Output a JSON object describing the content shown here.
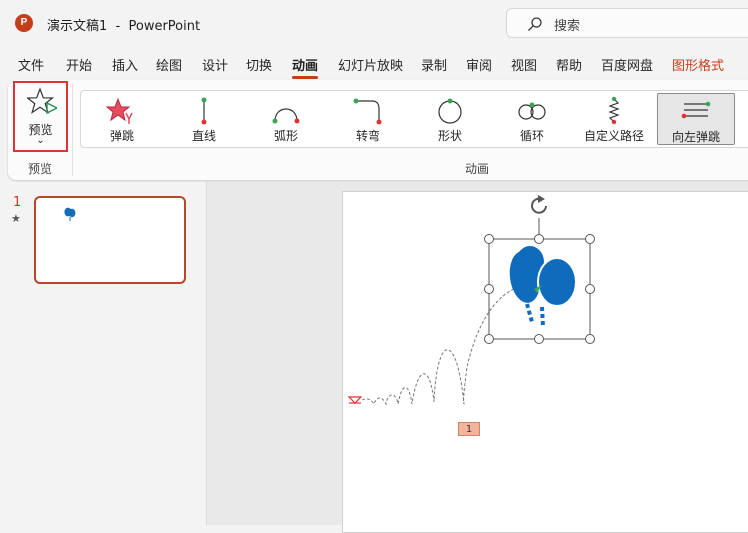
{
  "window": {
    "app_icon": "P",
    "title": "演示文稿1  -  PowerPoint",
    "search_placeholder": "搜索"
  },
  "tabs": [
    {
      "label": "文件"
    },
    {
      "label": "开始"
    },
    {
      "label": "插入"
    },
    {
      "label": "绘图"
    },
    {
      "label": "设计"
    },
    {
      "label": "切换"
    },
    {
      "label": "动画"
    },
    {
      "label": "幻灯片放映"
    },
    {
      "label": "录制"
    },
    {
      "label": "审阅"
    },
    {
      "label": "视图"
    },
    {
      "label": "帮助"
    },
    {
      "label": "百度网盘"
    },
    {
      "label": "图形格式"
    }
  ],
  "active_tab": "动画",
  "ribbon": {
    "preview_button": {
      "label": "预览",
      "chevron": "⌄"
    },
    "preview_group_label": "预览",
    "animation_group_label": "动画",
    "effects": [
      {
        "label": "弹跳",
        "icon": "bounce-star-icon"
      },
      {
        "label": "直线",
        "icon": "line-path-icon"
      },
      {
        "label": "弧形",
        "icon": "arc-path-icon"
      },
      {
        "label": "转弯",
        "icon": "turn-path-icon"
      },
      {
        "label": "形状",
        "icon": "shape-path-icon"
      },
      {
        "label": "循环",
        "icon": "loop-path-icon"
      },
      {
        "label": "自定义路径",
        "icon": "custom-path-icon"
      },
      {
        "label": "向左弹跳",
        "icon": "bounce-left-icon",
        "selected": true
      }
    ]
  },
  "slides_pane": {
    "slide_number": "1",
    "animation_marker": "★"
  },
  "canvas": {
    "animation_order_badge": "1",
    "object_icon": "balloons-icon"
  },
  "colors": {
    "accent": "#c43e1c",
    "balloon_blue": "#0f6cbd",
    "preview_highlight": "#e03232",
    "path_start_green": "#3aa655",
    "path_end_red": "#e03232"
  }
}
